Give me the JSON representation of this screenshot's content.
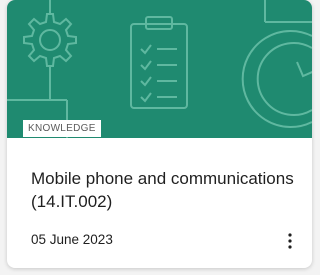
{
  "card": {
    "category_badge": "KNOWLEDGE",
    "title": "Mobile phone and communications (14.IT.002)",
    "date": "05 June 2023",
    "banner_icons": [
      "gear-icon",
      "clipboard-checklist-icon",
      "clock-refresh-icon"
    ],
    "more_icon": "vertical-ellipsis-icon"
  },
  "colors": {
    "banner": "#1f8a70",
    "banner_line": "#5fb8a0",
    "text": "#1f1f1f",
    "badge_text": "#5a5a5a"
  }
}
